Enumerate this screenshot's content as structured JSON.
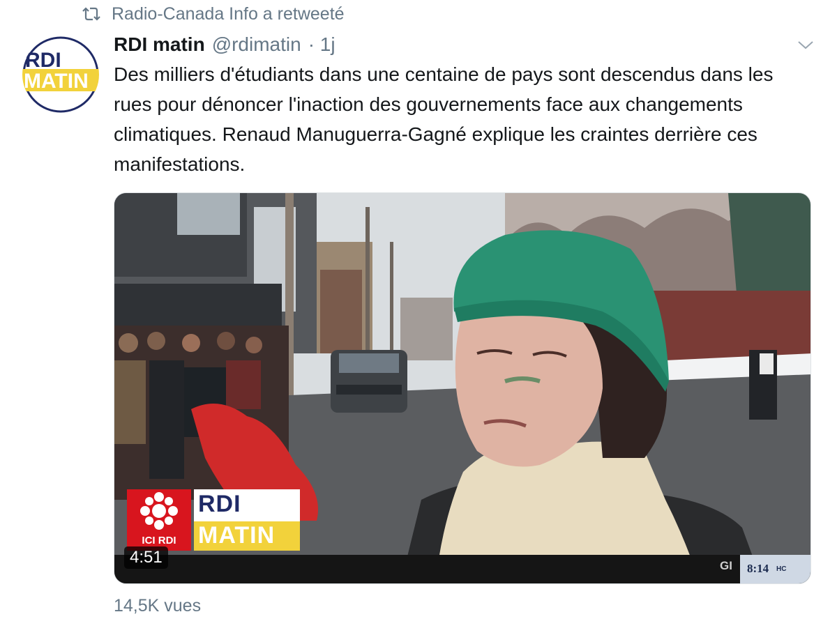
{
  "retweet": {
    "icon": "retweet-icon",
    "text": "Radio-Canada Info a retweeté"
  },
  "tweet": {
    "author_name": "RDI matin",
    "handle": "@rdimatin",
    "time": "· 1j",
    "text": "Des milliers d'étudiants dans une centaine de pays sont descendus dans les rues pour dénoncer l'inaction des gouvernements face aux changements climatiques. Renaud Manuguerra-Gagné explique les craintes derrière ces manifestations.",
    "menu_icon": "chevron-down-icon"
  },
  "avatar": {
    "line1": "RDI",
    "line2": "MATIN"
  },
  "video": {
    "duration": "4:51",
    "ici_label": "ICI RDI",
    "rdi_top": "RDI",
    "rdi_bottom": "MATIN",
    "ticker_fragment": "GI",
    "clock": "8:14",
    "clock_zone": "HC"
  },
  "views": "14,5K vues",
  "colors": {
    "muted": "#657786",
    "text": "#14171a",
    "radio_canada_red": "#d8151e",
    "rdi_yellow": "#f2d23b",
    "rdi_navy": "#1f2a66"
  }
}
